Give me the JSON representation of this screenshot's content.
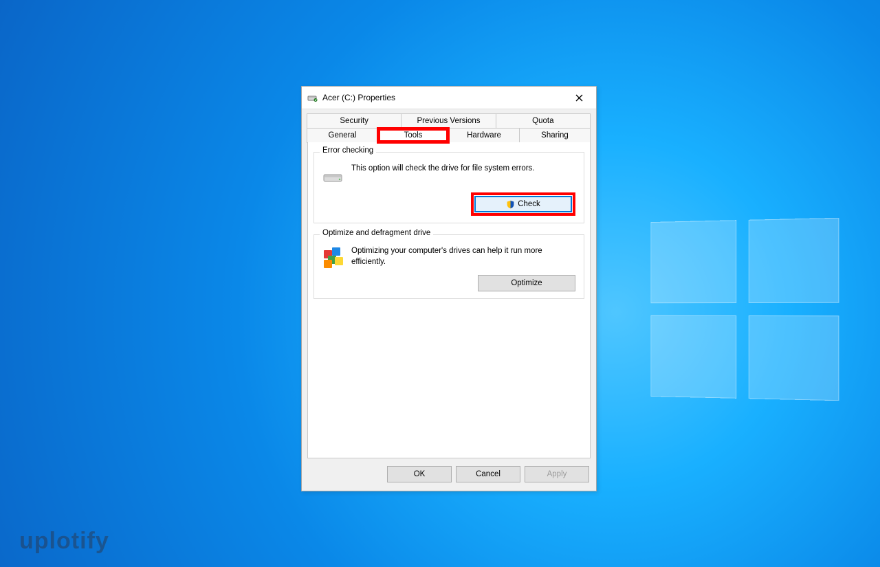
{
  "window": {
    "title": "Acer (C:) Properties"
  },
  "tabs": {
    "row1": [
      "Security",
      "Previous Versions",
      "Quota"
    ],
    "row2": [
      "General",
      "Tools",
      "Hardware",
      "Sharing"
    ],
    "active": "Tools"
  },
  "error_checking": {
    "legend": "Error checking",
    "description": "This option will check the drive for file system errors.",
    "button": "Check"
  },
  "optimize": {
    "legend": "Optimize and defragment drive",
    "description": "Optimizing your computer's drives can help it run more efficiently.",
    "button": "Optimize"
  },
  "footer": {
    "ok": "OK",
    "cancel": "Cancel",
    "apply": "Apply"
  },
  "watermark": "uplotify"
}
